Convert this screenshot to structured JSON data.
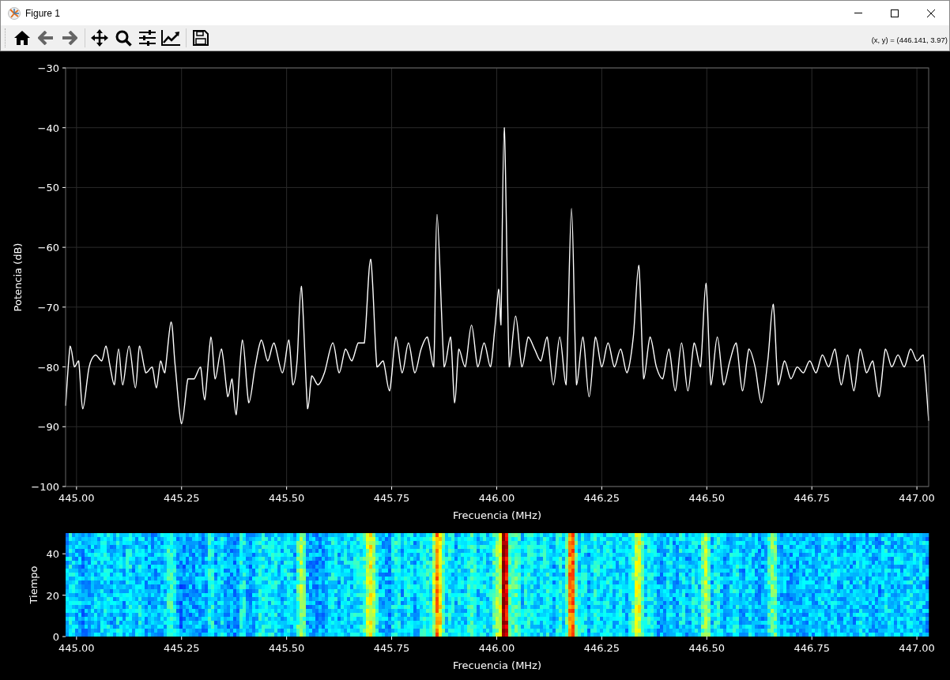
{
  "window": {
    "title": "Figure 1"
  },
  "toolbar": {
    "coordinates": "(x, y) = (446.141, 3.97)"
  },
  "spectrum": {
    "chart_data": {
      "type": "line",
      "grid": true,
      "xlabel": "Frecuencia (MHz)",
      "ylabel": "Potencia (dB)",
      "xlim": [
        444.974,
        447.028
      ],
      "ylim": [
        -100,
        -30
      ],
      "xticks": [
        {
          "value": 445,
          "label": "445.00"
        },
        {
          "value": 445.25,
          "label": "445.25"
        },
        {
          "value": 445.5,
          "label": "445.50"
        },
        {
          "value": 445.75,
          "label": "445.75"
        },
        {
          "value": 446,
          "label": "446.00"
        },
        {
          "value": 446.25,
          "label": "446.25"
        },
        {
          "value": 446.5,
          "label": "446.50"
        },
        {
          "value": 446.75,
          "label": "446.75"
        },
        {
          "value": 447,
          "label": "447.00"
        }
      ],
      "yticks": [
        {
          "value": -100,
          "label": "−100"
        },
        {
          "value": -90,
          "label": "−90"
        },
        {
          "value": -80,
          "label": "−80"
        },
        {
          "value": -70,
          "label": "−70"
        },
        {
          "value": -60,
          "label": "−60"
        },
        {
          "value": -50,
          "label": "−50"
        },
        {
          "value": -40,
          "label": "−40"
        },
        {
          "value": -30,
          "label": "−30"
        }
      ],
      "x": [
        444.974,
        444.985,
        444.995,
        445.005,
        445.015,
        445.03,
        445.045,
        445.06,
        445.07,
        445.08,
        445.09,
        445.1,
        445.11,
        445.125,
        445.14,
        445.15,
        445.165,
        445.18,
        445.19,
        445.2,
        445.21,
        445.225,
        445.235,
        445.25,
        445.265,
        445.28,
        445.295,
        445.305,
        445.32,
        445.33,
        445.345,
        445.36,
        445.37,
        445.38,
        445.395,
        445.41,
        445.425,
        445.44,
        445.455,
        445.47,
        445.49,
        445.505,
        445.515,
        445.525,
        445.535,
        445.55,
        445.56,
        445.575,
        445.59,
        445.61,
        445.625,
        445.64,
        445.655,
        445.67,
        445.685,
        445.7,
        445.715,
        445.73,
        445.745,
        445.76,
        445.775,
        445.79,
        445.805,
        445.82,
        445.835,
        445.85,
        445.858,
        445.875,
        445.89,
        445.9,
        445.91,
        445.925,
        445.94,
        445.955,
        445.97,
        445.985,
        445.995,
        446.005,
        446.01,
        446.018,
        446.03,
        446.045,
        446.06,
        446.075,
        446.09,
        446.105,
        446.12,
        446.135,
        446.15,
        446.165,
        446.178,
        446.19,
        446.205,
        446.22,
        446.235,
        446.25,
        446.265,
        446.28,
        446.295,
        446.31,
        446.325,
        446.338,
        446.35,
        446.365,
        446.38,
        446.395,
        446.41,
        446.425,
        446.44,
        446.455,
        446.47,
        446.485,
        446.498,
        446.51,
        446.525,
        446.54,
        446.555,
        446.57,
        446.585,
        446.6,
        446.615,
        446.63,
        446.645,
        446.658,
        446.67,
        446.685,
        446.7,
        446.715,
        446.73,
        446.745,
        446.76,
        446.775,
        446.79,
        446.805,
        446.82,
        446.835,
        446.85,
        446.865,
        446.88,
        446.895,
        446.91,
        446.925,
        446.94,
        446.955,
        446.97,
        446.985,
        447.0,
        447.015,
        447.028
      ],
      "series": [
        {
          "color": "#ffffff",
          "values": [
            -86.5,
            -76.5,
            -80,
            -79,
            -87,
            -80,
            -78,
            -79,
            -76.5,
            -80,
            -83,
            -77,
            -83,
            -76.5,
            -83.5,
            -76.5,
            -81,
            -80,
            -83.5,
            -79,
            -81,
            -72.5,
            -80,
            -89.5,
            -82,
            -82,
            -80,
            -85.5,
            -75,
            -82,
            -77,
            -85,
            -82,
            -88,
            -75.5,
            -86,
            -80,
            -75.5,
            -79,
            -76,
            -81,
            -75.5,
            -83,
            -79,
            -66.5,
            -87,
            -81.5,
            -83,
            -81,
            -76,
            -81,
            -77,
            -79,
            -76,
            -76,
            -62,
            -80,
            -79,
            -84,
            -75,
            -81,
            -76,
            -81,
            -77,
            -75,
            -80,
            -54.5,
            -80,
            -75,
            -86,
            -77,
            -80,
            -73,
            -80,
            -76,
            -80,
            -74,
            -67,
            -73,
            -40,
            -80,
            -71.5,
            -80,
            -75,
            -77,
            -79,
            -75,
            -83,
            -75,
            -83,
            -53.5,
            -83,
            -75,
            -85,
            -75,
            -80,
            -76,
            -80,
            -77,
            -81,
            -75,
            -63,
            -82,
            -75,
            -80,
            -82,
            -77,
            -84,
            -76,
            -84,
            -76,
            -80,
            -66,
            -83,
            -75,
            -83,
            -79,
            -76,
            -84,
            -77,
            -80,
            -86,
            -79,
            -69.5,
            -83,
            -79,
            -82,
            -80,
            -81,
            -79,
            -81,
            -78,
            -80,
            -77,
            -83,
            -78,
            -84,
            -77,
            -81,
            -79,
            -85,
            -77,
            -80,
            -78,
            -80,
            -77,
            -79,
            -78,
            -89
          ]
        }
      ]
    }
  },
  "spectrogram": {
    "xlabel": "Frecuencia (MHz)",
    "ylabel": "Tiempo",
    "xticks": [
      "445.00",
      "445.25",
      "445.50",
      "445.75",
      "446.00",
      "446.25",
      "446.50",
      "446.75",
      "447.00"
    ],
    "yticks": [
      "40",
      "20",
      "0"
    ]
  }
}
